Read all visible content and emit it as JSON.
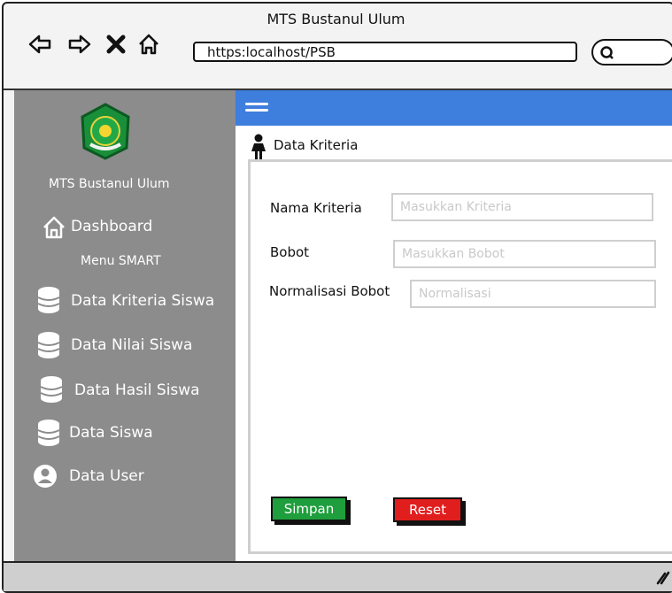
{
  "browser": {
    "title": "MTS Bustanul Ulum",
    "address": "https:localhost/PSB",
    "icons": [
      "back-arrow-icon",
      "forward-arrow-icon",
      "close-icon",
      "home-icon",
      "search-icon"
    ]
  },
  "sidebar": {
    "school_name": "MTS Bustanul Ulum",
    "dashboard_label": "Dashboard",
    "section_label": "Menu SMART",
    "items": [
      {
        "label": "Data Kriteria Siswa",
        "icon": "database-icon"
      },
      {
        "label": "Data Nilai Siswa",
        "icon": "database-icon"
      },
      {
        "label": "Data Hasil Siswa",
        "icon": "database-icon"
      },
      {
        "label": "Data Siswa",
        "icon": "database-icon"
      },
      {
        "label": "Data User",
        "icon": "user-circle-icon"
      }
    ]
  },
  "main": {
    "page_title": "Data Kriteria",
    "form": {
      "nama_label": "Nama  Kriteria",
      "nama_placeholder": "Masukkan Kriteria",
      "bobot_label": "Bobot",
      "bobot_placeholder": "Masukkan Bobot",
      "normalisasi_label": "Normalisasi Bobot",
      "normalisasi_placeholder": "Normalisasi"
    },
    "buttons": {
      "save_label": "Simpan",
      "reset_label": "Reset"
    }
  },
  "colors": {
    "sidebar": "#8c8c8c",
    "topbar": "#3e7edc",
    "save": "#1e9e3c",
    "reset": "#e01e1e"
  }
}
